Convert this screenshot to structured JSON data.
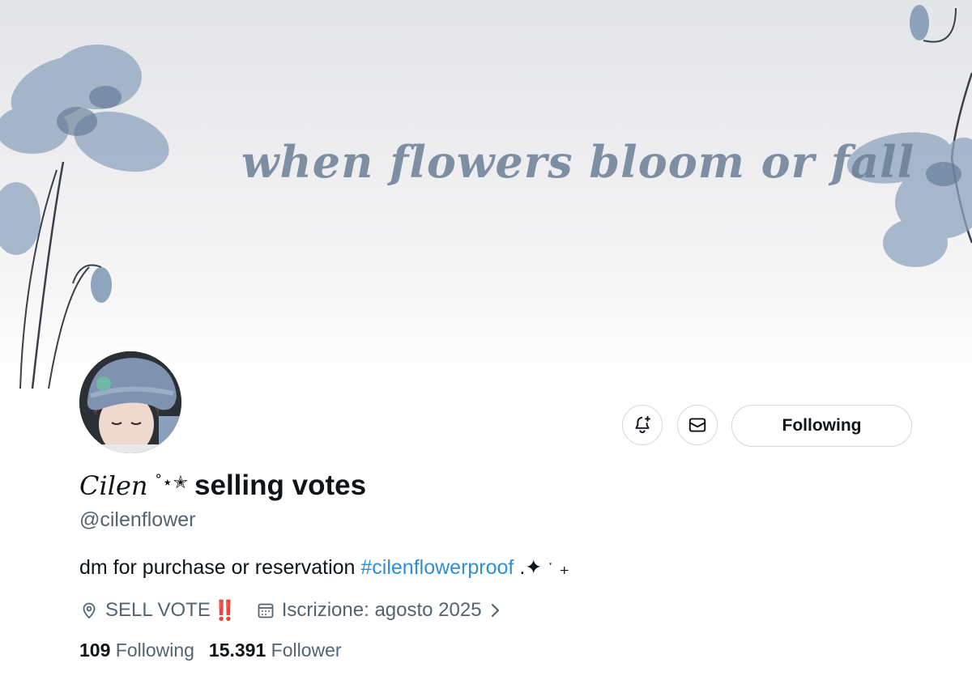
{
  "banner": {
    "text": "when flowers bloom or fall"
  },
  "actions": {
    "notify_icon": "bell-plus-icon",
    "message_icon": "envelope-icon",
    "follow_label": "Following"
  },
  "profile": {
    "display_name_script": "Cilen",
    "display_name_symbols": "˚⋆✭",
    "display_name_text": "selling votes",
    "handle": "@cilenflower",
    "bio_text": "dm for purchase or reservation",
    "bio_hashtag": "#cilenflowerproof",
    "bio_suffix": ".✦ ˑ ₊",
    "location": "SELL VOTE",
    "location_emoji": "‼️",
    "joined": "Iscrizione: agosto 2025"
  },
  "stats": {
    "following_count": "109",
    "following_label": "Following",
    "followers_count": "15.391",
    "followers_label": "Follower"
  },
  "colors": {
    "link": "#2f8fd6",
    "secondary_text": "#536471",
    "border": "#cfd9de",
    "banner_ink": "#6b7f96"
  }
}
